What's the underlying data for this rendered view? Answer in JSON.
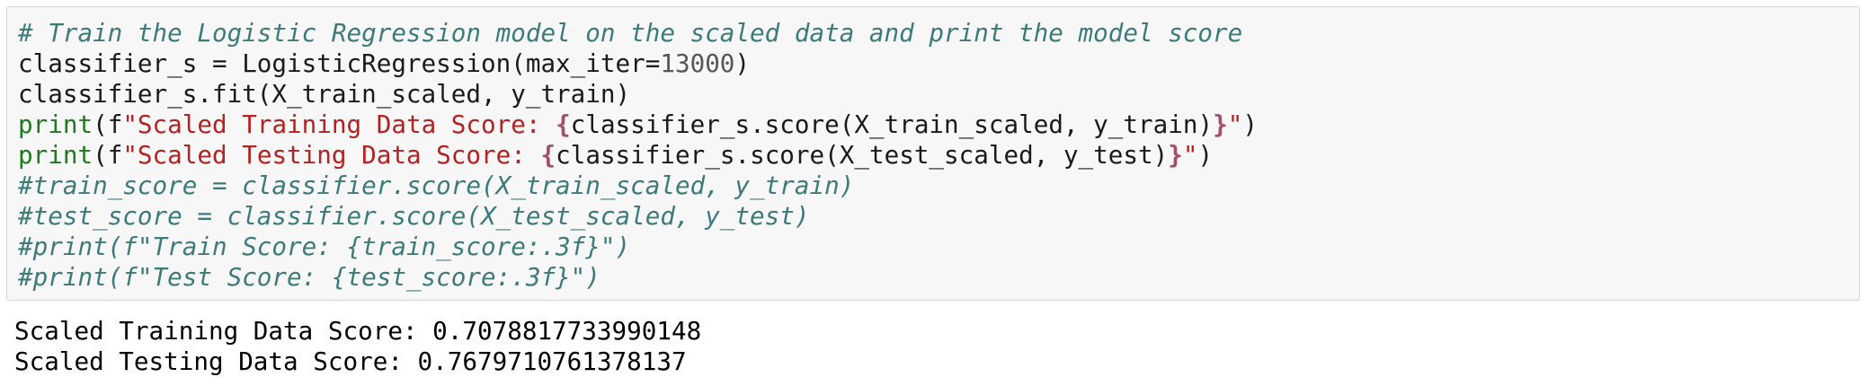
{
  "code_cell": {
    "lines": [
      {
        "comment": "# Train the Logistic Regression model on the scaled data and print the model score"
      },
      {
        "a": "classifier_s = LogisticRegression(max_iter=",
        "num": "13000",
        "b": ")"
      },
      {
        "text": "classifier_s.fit(X_train_scaled, y_train)"
      },
      {
        "kw": "print",
        "p1": "(f",
        "s1": "\"Scaled Training Data Score: ",
        "ob": "{",
        "expr": "classifier_s.score(X_train_scaled, y_train)",
        "cb": "}",
        "s2": "\"",
        "p2": ")"
      },
      {
        "kw": "print",
        "p1": "(f",
        "s1": "\"Scaled Testing Data Score: ",
        "ob": "{",
        "expr": "classifier_s.score(X_test_scaled, y_test)",
        "cb": "}",
        "s2": "\"",
        "p2": ")"
      },
      {
        "comment": "#train_score = classifier.score(X_train_scaled, y_train)"
      },
      {
        "comment": "#test_score = classifier.score(X_test_scaled, y_test)"
      },
      {
        "comment": "#print(f\"Train Score: {train_score:.3f}\")"
      },
      {
        "comment": "#print(f\"Test Score: {test_score:.3f}\")"
      }
    ]
  },
  "output": {
    "lines": [
      "Scaled Training Data Score: 0.7078817733990148",
      "Scaled Testing Data Score: 0.7679710761378137"
    ]
  },
  "colors": {
    "comment": "#3d7a7a",
    "keyword": "#1f7a1f",
    "string": "#b22222",
    "brace": "#a0506a",
    "cell_background": "#f7f7f7"
  }
}
